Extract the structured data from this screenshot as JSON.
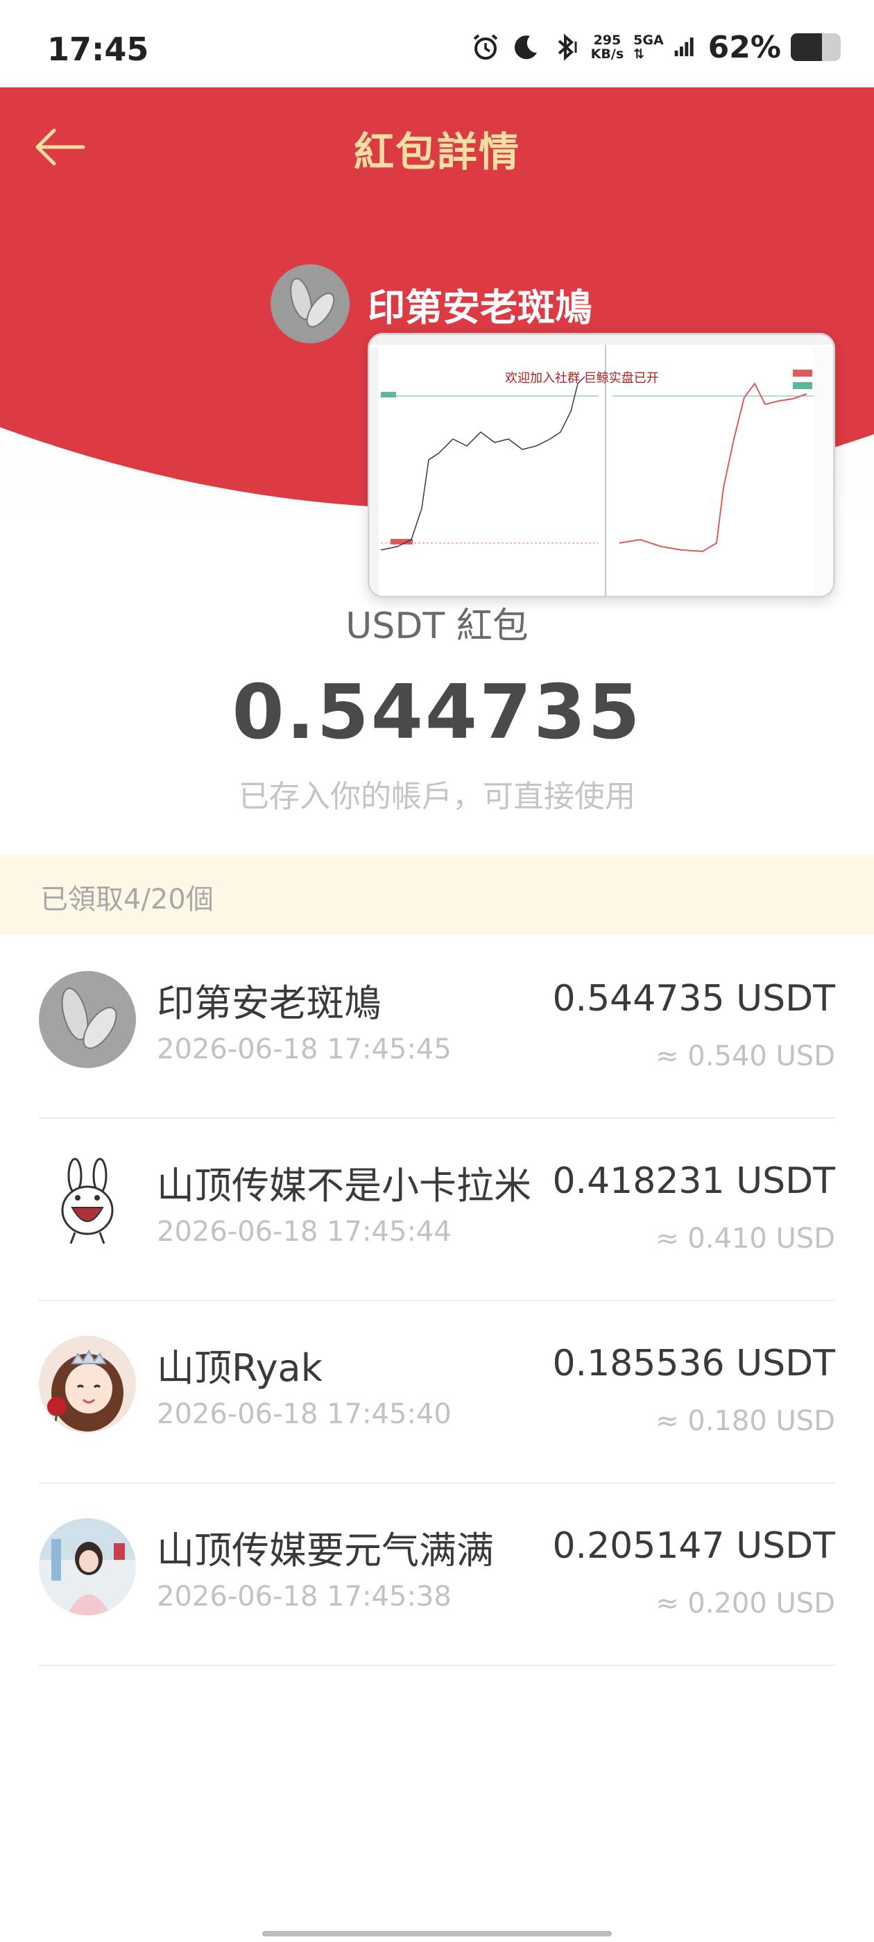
{
  "status_bar": {
    "time": "17:45",
    "net_speed_value": "295",
    "net_speed_unit": "KB/s",
    "signal_label": "5GA",
    "battery_percent": "62%",
    "battery_level": 0.62,
    "icons": [
      "alarm-icon",
      "moon-icon",
      "bluetooth-icon",
      "signal-icon",
      "battery-icon"
    ]
  },
  "header": {
    "title": "紅包詳情",
    "back_icon": "back-arrow-icon",
    "color_red": "#dc3b44",
    "color_gold": "#f6dfa3"
  },
  "sender": {
    "name": "印第安老斑鳩"
  },
  "overlay": {
    "caption": "欢迎加入社群 巨鲸实盘已开"
  },
  "packet": {
    "label": "USDT 紅包",
    "amount": "0.544735",
    "note": "已存入你的帳戶，可直接使用"
  },
  "claimed": {
    "text": "已領取4/20個"
  },
  "recipients": [
    {
      "name": "印第安老斑鳩",
      "time": "2026-06-18 17:45:45",
      "amount": "0.544735 USDT",
      "usd": "≈ 0.540 USD",
      "avatar": "shoe-print-avatar"
    },
    {
      "name": "山顶传媒不是小卡拉米",
      "time": "2026-06-18 17:45:44",
      "amount": "0.418231 USDT",
      "usd": "≈ 0.410 USD",
      "avatar": "bunny-avatar"
    },
    {
      "name": "山顶Ryak",
      "time": "2026-06-18 17:45:40",
      "amount": "0.185536 USDT",
      "usd": "≈ 0.180 USD",
      "avatar": "princess-avatar"
    },
    {
      "name": "山顶传媒要元气满满",
      "time": "2026-06-18 17:45:38",
      "amount": "0.205147 USDT",
      "usd": "≈ 0.200 USD",
      "avatar": "girl-photo-avatar"
    }
  ]
}
